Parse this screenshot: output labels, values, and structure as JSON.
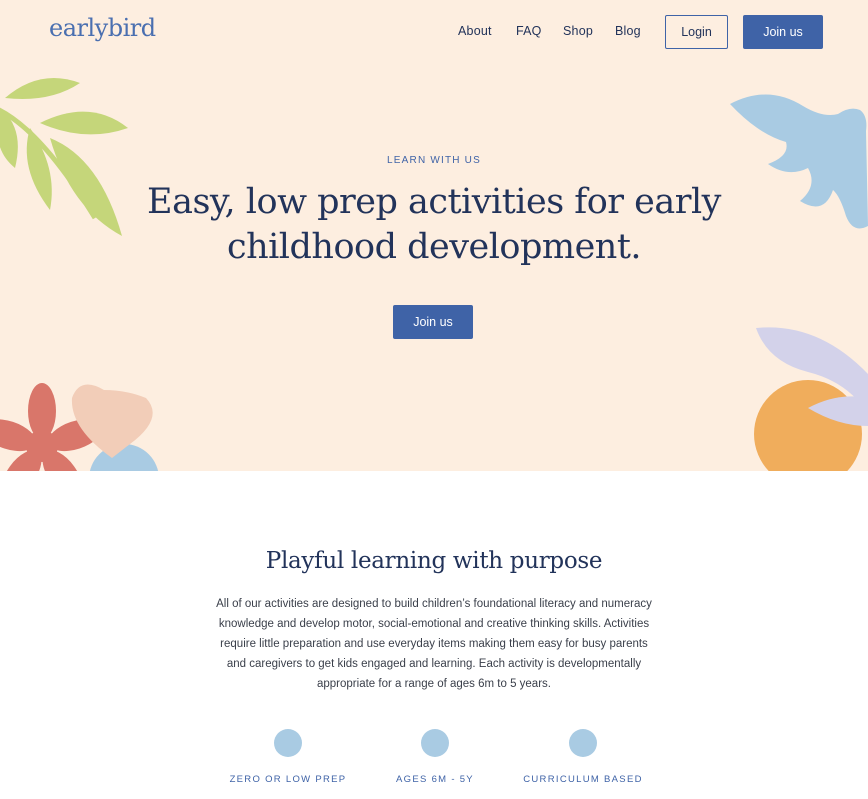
{
  "brand": {
    "logo": "earlybird"
  },
  "nav": {
    "about": "About",
    "faq": "FAQ",
    "shop": "Shop",
    "blog": "Blog",
    "login": "Login",
    "join": "Join us"
  },
  "hero": {
    "eyebrow": "LEARN WITH US",
    "headline": "Easy, low prep activities for early childhood development.",
    "cta": "Join us"
  },
  "section": {
    "title": "Playful learning with purpose",
    "body": "All of our activities are designed to build children’s foundational literacy and numeracy knowledge and develop motor, social-emotional and creative thinking skills. Activities require little preparation and use everyday items making them easy for busy parents and caregivers to get kids engaged and learning. Each activity is developmentally appropriate for a range of ages 6m to 5 years."
  },
  "features": [
    {
      "label": "ZERO OR LOW PREP"
    },
    {
      "label": "AGES 6M - 5Y"
    },
    {
      "label": "CURRICULUM BASED"
    }
  ],
  "colors": {
    "hero_bg": "#fdeee0",
    "primary": "#3f63a7",
    "navy": "#22335a",
    "leaf_green": "#c5d67a",
    "bird_blue": "#a9cbe3",
    "flower_red": "#d9766a",
    "heart_peach": "#f2cdb8",
    "orange": "#f0ad5c",
    "lavender": "#d3d2ea"
  },
  "icons": {
    "leaves": "leaf-branch-illustration",
    "bird": "bird-illustration",
    "flower": "flower-illustration",
    "heart": "heart-illustration",
    "orange": "orange-fruit-illustration"
  }
}
